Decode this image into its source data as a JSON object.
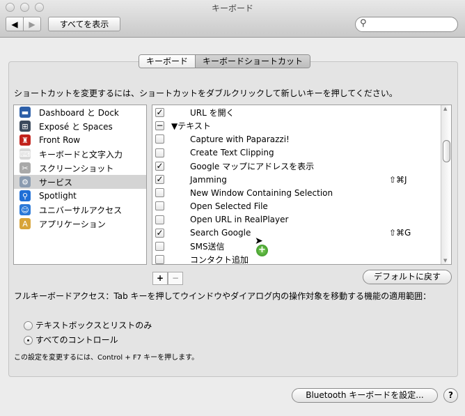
{
  "window": {
    "title": "キーボード"
  },
  "toolbar": {
    "back": "◀",
    "forward": "▶",
    "show_all": "すべてを表示",
    "search_placeholder": ""
  },
  "tabs": [
    {
      "label": "キーボード",
      "selected": false
    },
    {
      "label": "キーボードショートカット",
      "selected": true
    }
  ],
  "instructions": "ショートカットを変更するには、ショートカットをダブルクリックして新しいキーを押してください。",
  "categories": [
    {
      "label": "Dashboard と Dock",
      "icon": "dashboard-icon",
      "color": "#2d5fa8",
      "glyph": "▬"
    },
    {
      "label": "Exposé と Spaces",
      "icon": "expose-icon",
      "color": "#3b4a5c",
      "glyph": "⊞"
    },
    {
      "label": "Front Row",
      "icon": "front-row-icon",
      "color": "#c2231d",
      "glyph": "♜"
    },
    {
      "label": "キーボードと文字入力",
      "icon": "keyboard-icon",
      "color": "#d9d9d9",
      "glyph": "⌨"
    },
    {
      "label": "スクリーンショット",
      "icon": "screenshot-icon",
      "color": "#a9a9a9",
      "glyph": "✂"
    },
    {
      "label": "サービス",
      "icon": "gear-icon",
      "color": "#8a9bb0",
      "glyph": "⚙",
      "selected": true
    },
    {
      "label": "Spotlight",
      "icon": "spotlight-icon",
      "color": "#1f6fd6",
      "glyph": "⚲"
    },
    {
      "label": "ユニバーサルアクセス",
      "icon": "accessibility-icon",
      "color": "#2b79d8",
      "glyph": "☺"
    },
    {
      "label": "アプリケーション",
      "icon": "applications-icon",
      "color": "#d8a43a",
      "glyph": "A"
    }
  ],
  "services": [
    {
      "label": "URL を開く",
      "check": "✓",
      "shortcut": ""
    },
    {
      "label": "▼テキスト",
      "check": "−",
      "shortcut": "",
      "header": true
    },
    {
      "label": "Capture with Paparazzi!",
      "check": "",
      "shortcut": ""
    },
    {
      "label": "Create Text Clipping",
      "check": "",
      "shortcut": ""
    },
    {
      "label": "Google マップにアドレスを表示",
      "check": "✓",
      "shortcut": ""
    },
    {
      "label": "Jamming",
      "check": "✓",
      "shortcut": "⇧⌘J"
    },
    {
      "label": "New Window Containing Selection",
      "check": "",
      "shortcut": ""
    },
    {
      "label": "Open Selected File",
      "check": "",
      "shortcut": ""
    },
    {
      "label": "Open URL in RealPlayer",
      "check": "",
      "shortcut": ""
    },
    {
      "label": "Search Google",
      "check": "✓",
      "shortcut": "⇧⌘G"
    },
    {
      "label": "SMS送信",
      "check": "",
      "shortcut": ""
    },
    {
      "label": "コンタクト追加",
      "check": "",
      "shortcut": ""
    }
  ],
  "buttons": {
    "add": "+",
    "remove": "−",
    "restore_defaults": "デフォルトに戻す",
    "bluetooth": "Bluetooth キーボードを設定...",
    "help": "?"
  },
  "full_keyboard_access": {
    "label": "フルキーボードアクセス：Tab キーを押してウインドウやダイアログ内の操作対象を移動する機能の適用範囲：",
    "options": [
      {
        "label": "テキストボックスとリストのみ",
        "selected": false
      },
      {
        "label": "すべてのコントロール",
        "selected": true
      }
    ],
    "note": "この設定を変更するには、Control + F7 キーを押します。"
  }
}
